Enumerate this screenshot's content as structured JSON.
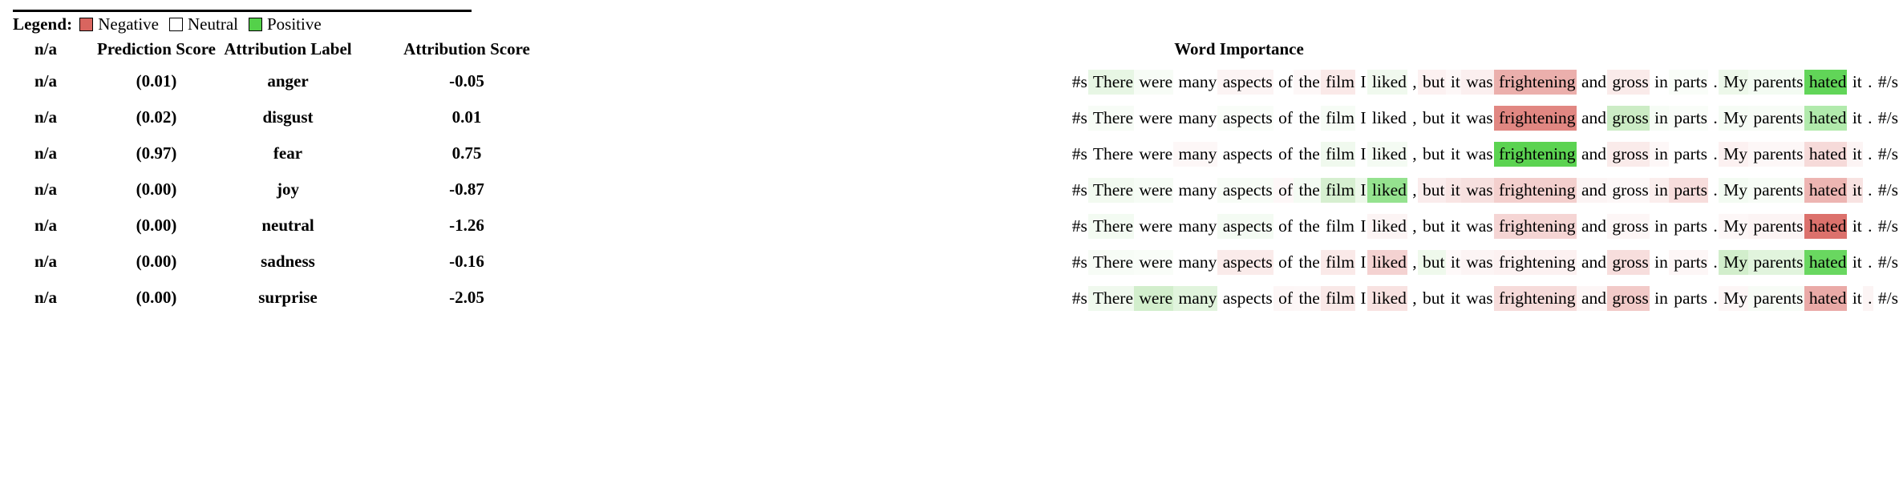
{
  "legend": {
    "title": "Legend:",
    "items": [
      {
        "label": "Negative",
        "color": "#d9655f"
      },
      {
        "label": "Neutral",
        "color": "#ffffff"
      },
      {
        "label": "Positive",
        "color": "#54d14a"
      }
    ]
  },
  "table": {
    "headers": {
      "na": "n/a",
      "prediction_score": "Prediction Score",
      "attribution_label": "Attribution Label",
      "attribution_score": "Attribution Score",
      "word_importance": "Word Importance"
    },
    "rows": [
      {
        "na": "n/a",
        "prediction_score": "(0.01)",
        "attribution_label": "anger",
        "attribution_score": "-0.05",
        "tokens": [
          {
            "text": "#s",
            "color": "rgba(255,255,255,0)"
          },
          {
            "text": " There",
            "color": "rgba(106,199,86,0.16)"
          },
          {
            "text": " were",
            "color": "rgba(106,199,86,0.05)"
          },
          {
            "text": " many",
            "color": "rgba(255,255,255,0)"
          },
          {
            "text": " aspects",
            "color": "rgba(217,101,95,0.07)"
          },
          {
            "text": " of",
            "color": "rgba(255,255,255,0)"
          },
          {
            "text": " the",
            "color": "rgba(217,101,95,0.05)"
          },
          {
            "text": " film",
            "color": "rgba(217,101,95,0.14)"
          },
          {
            "text": " I",
            "color": "rgba(255,255,255,0)"
          },
          {
            "text": " liked",
            "color": "rgba(106,199,86,0.10)"
          },
          {
            "text": " ,",
            "color": "rgba(255,255,255,0)"
          },
          {
            "text": " but",
            "color": "rgba(217,101,95,0.09)"
          },
          {
            "text": " it",
            "color": "rgba(217,101,95,0.05)"
          },
          {
            "text": " was",
            "color": "rgba(217,101,95,0.10)"
          },
          {
            "text": " frightening",
            "color": "rgba(217,101,95,0.52)"
          },
          {
            "text": " and",
            "color": "rgba(255,255,255,0)"
          },
          {
            "text": " gross",
            "color": "rgba(217,101,95,0.13)"
          },
          {
            "text": " in",
            "color": "rgba(255,255,255,0)"
          },
          {
            "text": " parts",
            "color": "rgba(106,199,86,0.04)"
          },
          {
            "text": " .",
            "color": "rgba(255,255,255,0)"
          },
          {
            "text": " My",
            "color": "rgba(106,199,86,0.12)"
          },
          {
            "text": " parents",
            "color": "rgba(106,199,86,0.08)"
          },
          {
            "text": " hated",
            "color": "rgba(84,209,74,0.92)"
          },
          {
            "text": " it",
            "color": "rgba(255,255,255,0)"
          },
          {
            "text": " .",
            "color": "rgba(255,255,255,0)"
          },
          {
            "text": " #/s",
            "color": "rgba(255,255,255,0)"
          }
        ]
      },
      {
        "na": "n/a",
        "prediction_score": "(0.02)",
        "attribution_label": "disgust",
        "attribution_score": "0.01",
        "tokens": [
          {
            "text": "#s",
            "color": "rgba(255,255,255,0)"
          },
          {
            "text": " There",
            "color": "rgba(106,199,86,0.05)"
          },
          {
            "text": " were",
            "color": "rgba(255,255,255,0)"
          },
          {
            "text": " many",
            "color": "rgba(255,255,255,0)"
          },
          {
            "text": " aspects",
            "color": "rgba(106,199,86,0.04)"
          },
          {
            "text": " of",
            "color": "rgba(255,255,255,0)"
          },
          {
            "text": " the",
            "color": "rgba(255,255,255,0)"
          },
          {
            "text": " film",
            "color": "rgba(106,199,86,0.06)"
          },
          {
            "text": " I",
            "color": "rgba(255,255,255,0)"
          },
          {
            "text": " liked",
            "color": "rgba(255,255,255,0)"
          },
          {
            "text": " ,",
            "color": "rgba(255,255,255,0)"
          },
          {
            "text": " but",
            "color": "rgba(255,255,255,0)"
          },
          {
            "text": " it",
            "color": "rgba(255,255,255,0)"
          },
          {
            "text": " was",
            "color": "rgba(255,255,255,0)"
          },
          {
            "text": " frightening",
            "color": "rgba(217,101,95,0.78)"
          },
          {
            "text": " and",
            "color": "rgba(255,255,255,0)"
          },
          {
            "text": " gross",
            "color": "rgba(106,199,86,0.34)"
          },
          {
            "text": " in",
            "color": "rgba(106,199,86,0.06)"
          },
          {
            "text": " parts",
            "color": "rgba(106,199,86,0.04)"
          },
          {
            "text": " .",
            "color": "rgba(255,255,255,0)"
          },
          {
            "text": " My",
            "color": "rgba(106,199,86,0.06)"
          },
          {
            "text": " parents",
            "color": "rgba(106,199,86,0.05)"
          },
          {
            "text": " hated",
            "color": "rgba(84,209,74,0.46)"
          },
          {
            "text": " it",
            "color": "rgba(255,255,255,0)"
          },
          {
            "text": " .",
            "color": "rgba(255,255,255,0)"
          },
          {
            "text": " #/s",
            "color": "rgba(255,255,255,0)"
          }
        ]
      },
      {
        "na": "n/a",
        "prediction_score": "(0.97)",
        "attribution_label": "fear",
        "attribution_score": "0.75",
        "tokens": [
          {
            "text": "#s",
            "color": "rgba(255,255,255,0)"
          },
          {
            "text": " There",
            "color": "rgba(255,255,255,0)"
          },
          {
            "text": " were",
            "color": "rgba(255,255,255,0)"
          },
          {
            "text": " many",
            "color": "rgba(217,101,95,0.05)"
          },
          {
            "text": " aspects",
            "color": "rgba(255,255,255,0)"
          },
          {
            "text": " of",
            "color": "rgba(255,255,255,0)"
          },
          {
            "text": " the",
            "color": "rgba(255,255,255,0)"
          },
          {
            "text": " film",
            "color": "rgba(106,199,86,0.10)"
          },
          {
            "text": " I",
            "color": "rgba(255,255,255,0)"
          },
          {
            "text": " liked",
            "color": "rgba(106,199,86,0.07)"
          },
          {
            "text": " ,",
            "color": "rgba(255,255,255,0)"
          },
          {
            "text": " but",
            "color": "rgba(255,255,255,0)"
          },
          {
            "text": " it",
            "color": "rgba(255,255,255,0)"
          },
          {
            "text": " was",
            "color": "rgba(255,255,255,0)"
          },
          {
            "text": " frightening",
            "color": "rgba(84,209,74,0.96)"
          },
          {
            "text": " and",
            "color": "rgba(255,255,255,0)"
          },
          {
            "text": " gross",
            "color": "rgba(217,101,95,0.13)"
          },
          {
            "text": " in",
            "color": "rgba(217,101,95,0.05)"
          },
          {
            "text": " parts",
            "color": "rgba(255,255,255,0)"
          },
          {
            "text": " .",
            "color": "rgba(255,255,255,0)"
          },
          {
            "text": " My",
            "color": "rgba(217,101,95,0.09)"
          },
          {
            "text": " parents",
            "color": "rgba(217,101,95,0.05)"
          },
          {
            "text": " hated",
            "color": "rgba(217,101,95,0.24)"
          },
          {
            "text": " it",
            "color": "rgba(217,101,95,0.07)"
          },
          {
            "text": " .",
            "color": "rgba(255,255,255,0)"
          },
          {
            "text": " #/s",
            "color": "rgba(255,255,255,0)"
          }
        ]
      },
      {
        "na": "n/a",
        "prediction_score": "(0.00)",
        "attribution_label": "joy",
        "attribution_score": "-0.87",
        "tokens": [
          {
            "text": "#s",
            "color": "rgba(255,255,255,0)"
          },
          {
            "text": " There",
            "color": "rgba(106,199,86,0.09)"
          },
          {
            "text": " were",
            "color": "rgba(106,199,86,0.06)"
          },
          {
            "text": " many",
            "color": "rgba(255,255,255,0)"
          },
          {
            "text": " aspects",
            "color": "rgba(106,199,86,0.05)"
          },
          {
            "text": " of",
            "color": "rgba(217,101,95,0.05)"
          },
          {
            "text": " the",
            "color": "rgba(106,199,86,0.07)"
          },
          {
            "text": " film",
            "color": "rgba(106,199,86,0.28)"
          },
          {
            "text": " I",
            "color": "rgba(106,199,86,0.12)"
          },
          {
            "text": " liked",
            "color": "rgba(84,209,74,0.62)"
          },
          {
            "text": " ,",
            "color": "rgba(255,255,255,0)"
          },
          {
            "text": " but",
            "color": "rgba(217,101,95,0.12)"
          },
          {
            "text": " it",
            "color": "rgba(217,101,95,0.17)"
          },
          {
            "text": " was",
            "color": "rgba(217,101,95,0.20)"
          },
          {
            "text": " frightening",
            "color": "rgba(217,101,95,0.31)"
          },
          {
            "text": " and",
            "color": "rgba(217,101,95,0.07)"
          },
          {
            "text": " gross",
            "color": "rgba(217,101,95,0.05)"
          },
          {
            "text": " in",
            "color": "rgba(217,101,95,0.11)"
          },
          {
            "text": " parts",
            "color": "rgba(217,101,95,0.22)"
          },
          {
            "text": " .",
            "color": "rgba(255,255,255,0)"
          },
          {
            "text": " My",
            "color": "rgba(106,199,86,0.08)"
          },
          {
            "text": " parents",
            "color": "rgba(106,199,86,0.05)"
          },
          {
            "text": " hated",
            "color": "rgba(217,101,95,0.48)"
          },
          {
            "text": " it",
            "color": "rgba(217,101,95,0.18)"
          },
          {
            "text": " .",
            "color": "rgba(255,255,255,0)"
          },
          {
            "text": " #/s",
            "color": "rgba(255,255,255,0)"
          }
        ]
      },
      {
        "na": "n/a",
        "prediction_score": "(0.00)",
        "attribution_label": "neutral",
        "attribution_score": "-1.26",
        "tokens": [
          {
            "text": "#s",
            "color": "rgba(255,255,255,0)"
          },
          {
            "text": " There",
            "color": "rgba(106,199,86,0.08)"
          },
          {
            "text": " were",
            "color": "rgba(255,255,255,0)"
          },
          {
            "text": " many",
            "color": "rgba(255,255,255,0)"
          },
          {
            "text": " aspects",
            "color": "rgba(106,199,86,0.07)"
          },
          {
            "text": " of",
            "color": "rgba(255,255,255,0)"
          },
          {
            "text": " the",
            "color": "rgba(255,255,255,0)"
          },
          {
            "text": " film",
            "color": "rgba(255,255,255,0)"
          },
          {
            "text": " I",
            "color": "rgba(255,255,255,0)"
          },
          {
            "text": " liked",
            "color": "rgba(217,101,95,0.07)"
          },
          {
            "text": " ,",
            "color": "rgba(255,255,255,0)"
          },
          {
            "text": " but",
            "color": "rgba(255,255,255,0)"
          },
          {
            "text": " it",
            "color": "rgba(255,255,255,0)"
          },
          {
            "text": " was",
            "color": "rgba(255,255,255,0)"
          },
          {
            "text": " frightening",
            "color": "rgba(217,101,95,0.27)"
          },
          {
            "text": " and",
            "color": "rgba(255,255,255,0)"
          },
          {
            "text": " gross",
            "color": "rgba(217,101,95,0.06)"
          },
          {
            "text": " in",
            "color": "rgba(255,255,255,0)"
          },
          {
            "text": " parts",
            "color": "rgba(255,255,255,0)"
          },
          {
            "text": " .",
            "color": "rgba(255,255,255,0)"
          },
          {
            "text": " My",
            "color": "rgba(217,101,95,0.05)"
          },
          {
            "text": " parents",
            "color": "rgba(217,101,95,0.07)"
          },
          {
            "text": " hated",
            "color": "rgba(217,101,95,0.92)"
          },
          {
            "text": " it",
            "color": "rgba(255,255,255,0)"
          },
          {
            "text": " .",
            "color": "rgba(255,255,255,0)"
          },
          {
            "text": " #/s",
            "color": "rgba(255,255,255,0)"
          }
        ]
      },
      {
        "na": "n/a",
        "prediction_score": "(0.00)",
        "attribution_label": "sadness",
        "attribution_score": "-0.16",
        "tokens": [
          {
            "text": "#s",
            "color": "rgba(255,255,255,0)"
          },
          {
            "text": " There",
            "color": "rgba(106,199,86,0.05)"
          },
          {
            "text": " were",
            "color": "rgba(106,199,86,0.04)"
          },
          {
            "text": " many",
            "color": "rgba(255,255,255,0)"
          },
          {
            "text": " aspects",
            "color": "rgba(217,101,95,0.13)"
          },
          {
            "text": " of",
            "color": "rgba(255,255,255,0)"
          },
          {
            "text": " the",
            "color": "rgba(255,255,255,0)"
          },
          {
            "text": " film",
            "color": "rgba(217,101,95,0.14)"
          },
          {
            "text": " I",
            "color": "rgba(255,255,255,0)"
          },
          {
            "text": " liked",
            "color": "rgba(217,101,95,0.29)"
          },
          {
            "text": " ,",
            "color": "rgba(255,255,255,0)"
          },
          {
            "text": " but",
            "color": "rgba(106,199,86,0.11)"
          },
          {
            "text": " it",
            "color": "rgba(217,101,95,0.04)"
          },
          {
            "text": " was",
            "color": "rgba(217,101,95,0.07)"
          },
          {
            "text": " frightening",
            "color": "rgba(217,101,95,0.09)"
          },
          {
            "text": " and",
            "color": "rgba(255,255,255,0)"
          },
          {
            "text": " gross",
            "color": "rgba(217,101,95,0.21)"
          },
          {
            "text": " in",
            "color": "rgba(255,255,255,0)"
          },
          {
            "text": " parts",
            "color": "rgba(217,101,95,0.06)"
          },
          {
            "text": " .",
            "color": "rgba(255,255,255,0)"
          },
          {
            "text": " My",
            "color": "rgba(106,199,86,0.30)"
          },
          {
            "text": " parents",
            "color": "rgba(106,199,86,0.20)"
          },
          {
            "text": " hated",
            "color": "rgba(84,209,74,0.88)"
          },
          {
            "text": " it",
            "color": "rgba(255,255,255,0)"
          },
          {
            "text": " .",
            "color": "rgba(255,255,255,0)"
          },
          {
            "text": " #/s",
            "color": "rgba(255,255,255,0)"
          }
        ]
      },
      {
        "na": "n/a",
        "prediction_score": "(0.00)",
        "attribution_label": "surprise",
        "attribution_score": "-2.05",
        "tokens": [
          {
            "text": "#s",
            "color": "rgba(255,255,255,0)"
          },
          {
            "text": " There",
            "color": "rgba(106,199,86,0.10)"
          },
          {
            "text": " were",
            "color": "rgba(106,199,86,0.30)"
          },
          {
            "text": " many",
            "color": "rgba(106,199,86,0.20)"
          },
          {
            "text": " aspects",
            "color": "rgba(255,255,255,0)"
          },
          {
            "text": " of",
            "color": "rgba(217,101,95,0.06)"
          },
          {
            "text": " the",
            "color": "rgba(217,101,95,0.05)"
          },
          {
            "text": " film",
            "color": "rgba(217,101,95,0.15)"
          },
          {
            "text": " I",
            "color": "rgba(255,255,255,0)"
          },
          {
            "text": " liked",
            "color": "rgba(217,101,95,0.19)"
          },
          {
            "text": " ,",
            "color": "rgba(255,255,255,0)"
          },
          {
            "text": " but",
            "color": "rgba(255,255,255,0)"
          },
          {
            "text": " it",
            "color": "rgba(255,255,255,0)"
          },
          {
            "text": " was",
            "color": "rgba(255,255,255,0)"
          },
          {
            "text": " frightening",
            "color": "rgba(217,101,95,0.23)"
          },
          {
            "text": " and",
            "color": "rgba(217,101,95,0.06)"
          },
          {
            "text": " gross",
            "color": "rgba(217,101,95,0.34)"
          },
          {
            "text": " in",
            "color": "rgba(255,255,255,0)"
          },
          {
            "text": " parts",
            "color": "rgba(255,255,255,0)"
          },
          {
            "text": " .",
            "color": "rgba(255,255,255,0)"
          },
          {
            "text": " My",
            "color": "rgba(217,101,95,0.06)"
          },
          {
            "text": " parents",
            "color": "rgba(106,199,86,0.05)"
          },
          {
            "text": " hated",
            "color": "rgba(217,101,95,0.55)"
          },
          {
            "text": " it",
            "color": "rgba(255,255,255,0)"
          },
          {
            "text": " .",
            "color": "rgba(217,101,95,0.07)"
          },
          {
            "text": " #/s",
            "color": "rgba(255,255,255,0)"
          }
        ]
      }
    ]
  }
}
